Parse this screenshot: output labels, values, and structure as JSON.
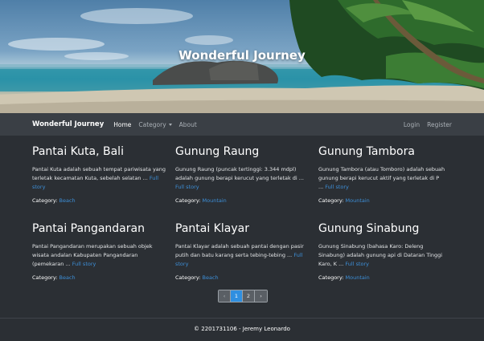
{
  "hero": {
    "title": "Wonderful Journey"
  },
  "navbar": {
    "brand": "Wonderful Journey",
    "links": [
      {
        "label": "Home"
      },
      {
        "label": "Category"
      },
      {
        "label": "About"
      }
    ],
    "right_links": [
      {
        "label": "Login"
      },
      {
        "label": "Register"
      }
    ]
  },
  "posts": [
    {
      "title": "Pantai Kuta, Bali",
      "excerpt": "Pantai Kuta adalah sebuah tempat pariwisata yang terletak kecamatan Kuta, sebelah selatan ...",
      "full_story": "Full story",
      "category_label": "Category:",
      "category": "Beach"
    },
    {
      "title": "Gunung Raung",
      "excerpt": "Gunung Raung (puncak tertinggi: 3.344 mdpl) adalah gunung berapi kerucut yang terletak di ...",
      "full_story": "Full story",
      "category_label": "Category:",
      "category": "Mountain"
    },
    {
      "title": "Gunung Tambora",
      "excerpt": "Gunung Tambora (atau Tomboro) adalah sebuah gunung berapi kerucut aktif yang terletak di P ...",
      "full_story": "Full story",
      "category_label": "Category:",
      "category": "Mountain"
    },
    {
      "title": "Pantai Pangandaran",
      "excerpt": "Pantai Pangandaran merupakan sebuah objek wisata andalan Kabupaten Pangandaran (pemekaran ...",
      "full_story": "Full story",
      "category_label": "Category:",
      "category": "Beach"
    },
    {
      "title": "Pantai Klayar",
      "excerpt": "Pantai Klayar adalah sebuah pantai dengan pasir putih dan batu karang serta tebing-tebing ...",
      "full_story": "Full story",
      "category_label": "Category:",
      "category": "Beach"
    },
    {
      "title": "Gunung Sinabung",
      "excerpt": "Gunung Sinabung (bahasa Karo: Deleng Sinabung) adalah gunung api di Dataran Tinggi Karo, K ...",
      "full_story": "Full story",
      "category_label": "Category:",
      "category": "Mountain"
    }
  ],
  "pagination": {
    "prev": "‹",
    "pages": [
      "1",
      "2"
    ],
    "current": "1",
    "next": "›"
  },
  "footer": {
    "text": "© 2201731106 - Jeremy Leonardo"
  },
  "colors": {
    "background": "#2b2f34",
    "navbar": "#3a3f45",
    "link": "#3d8fd8",
    "active_page": "#2f8fe0"
  }
}
